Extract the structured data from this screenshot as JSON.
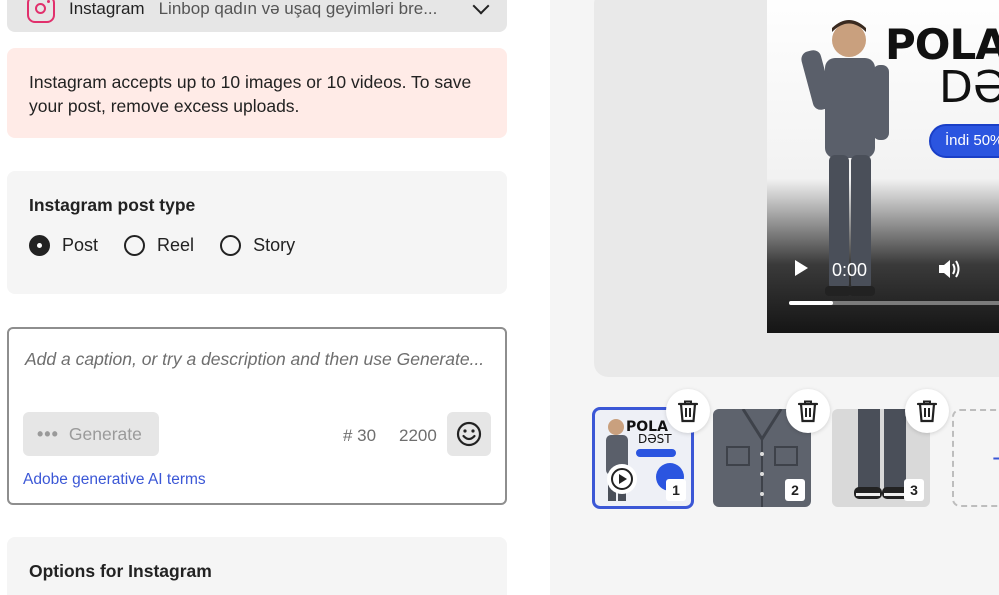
{
  "account": {
    "network": "Instagram",
    "description": "Linbop qadın və uşaq geyimləri bre..."
  },
  "alert": {
    "text": "Instagram accepts up to 10 images or 10 videos. To save your post, remove excess uploads."
  },
  "post_type": {
    "title": "Instagram post type",
    "options": [
      {
        "label": "Post",
        "selected": true
      },
      {
        "label": "Reel",
        "selected": false
      },
      {
        "label": "Story",
        "selected": false
      }
    ]
  },
  "caption": {
    "placeholder": "Add a caption, or try a description and then use Generate...",
    "generate_label": "Generate",
    "hashtag_count": "# 30",
    "char_count": "2200",
    "ai_terms_link": "Adobe generative AI terms"
  },
  "options": {
    "title": "Options for Instagram"
  },
  "preview": {
    "brand_text": "POLA",
    "brand_sub": "DƏ",
    "pill_text": "İndi 50%",
    "time": "0:00",
    "progress_fraction": 0.2
  },
  "thumbnails": [
    {
      "index": "1",
      "selected": true,
      "kind": "video"
    },
    {
      "index": "2",
      "selected": false,
      "kind": "image"
    },
    {
      "index": "3",
      "selected": false,
      "kind": "image"
    }
  ],
  "colors": {
    "accent": "#3b57d6",
    "alert_bg": "#ffebe7",
    "instagram": "#e1306c"
  }
}
